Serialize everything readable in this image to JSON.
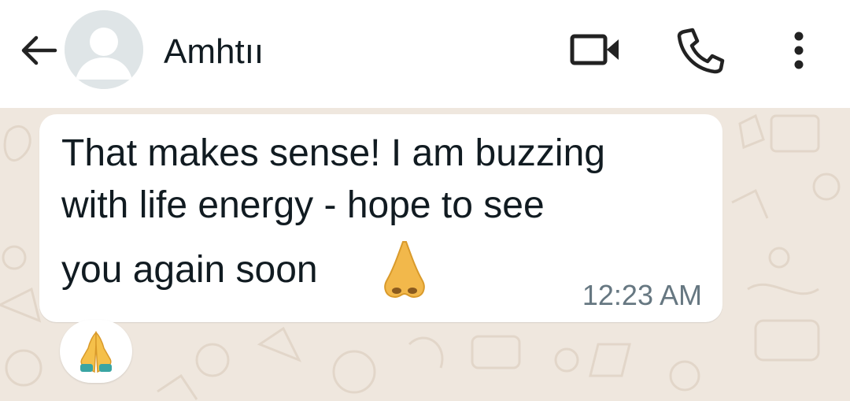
{
  "header": {
    "contact_name": "Amhtıı"
  },
  "icons": {
    "back": "arrow-left-icon",
    "avatar": "default-avatar-icon",
    "video": "video-call-icon",
    "phone": "voice-call-icon",
    "more": "more-vertical-icon"
  },
  "message": {
    "line1": "That makes sense! I am buzzing",
    "line2": "with life energy - hope to see",
    "line3": "you again soon",
    "emoji": "nose",
    "time": "12:23 AM"
  },
  "reaction": {
    "emoji": "folded-hands"
  },
  "colors": {
    "header_bg": "#ffffff",
    "wallpaper_bg": "#efe7de",
    "bubble_bg": "#ffffff",
    "text": "#111b21",
    "timestamp": "#667781"
  }
}
